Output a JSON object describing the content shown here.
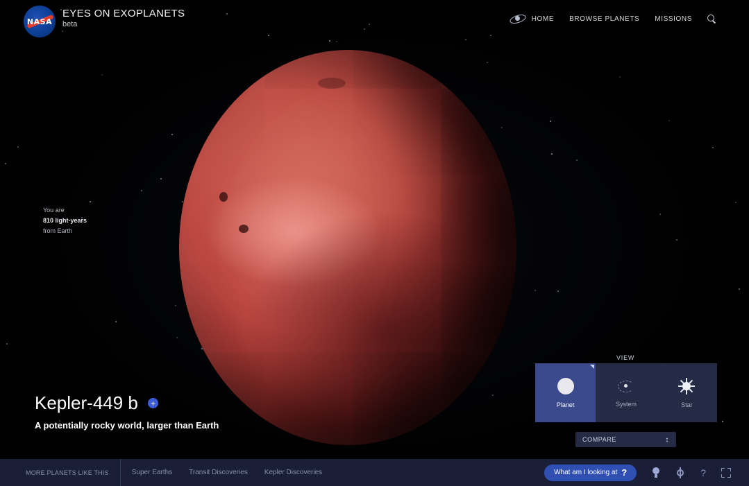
{
  "brand": {
    "title": "EYES ON EXOPLANETS",
    "subtitle": "beta",
    "logo_text": "NASA"
  },
  "nav": {
    "home": "HOME",
    "browse": "BROWSE PLANETS",
    "missions": "MISSIONS"
  },
  "distance": {
    "line1": "You are",
    "line2": "810 light-years",
    "line3": "from Earth"
  },
  "planet": {
    "name": "Kepler-449 b",
    "description": "A potentially rocky world, larger than Earth",
    "plus": "+"
  },
  "view": {
    "label": "VIEW",
    "options": [
      {
        "label": "Planet",
        "active": true
      },
      {
        "label": "System",
        "active": false
      },
      {
        "label": "Star",
        "active": false
      }
    ]
  },
  "compare": {
    "label": "COMPARE",
    "arrow": "↕"
  },
  "bottom_bar": {
    "more_label": "MORE PLANETS LIKE THIS",
    "links": [
      "Super Earths",
      "Transit Discoveries",
      "Kepler Discoveries"
    ],
    "looking_label": "What am I looking at",
    "looking_q": "?",
    "help": "?"
  },
  "colors": {
    "accent": "#3b5bdb",
    "panel": "#262b45",
    "active_panel": "#3b4a8c",
    "bar": "#1a1f37",
    "planet": "#b9453f"
  },
  "icons": [
    "nasa-logo",
    "galaxy-icon",
    "search-icon",
    "plus-icon",
    "globe-icon",
    "system-icon",
    "star-icon",
    "bulb-icon",
    "gear-icon",
    "help-icon",
    "fullscreen-icon"
  ]
}
